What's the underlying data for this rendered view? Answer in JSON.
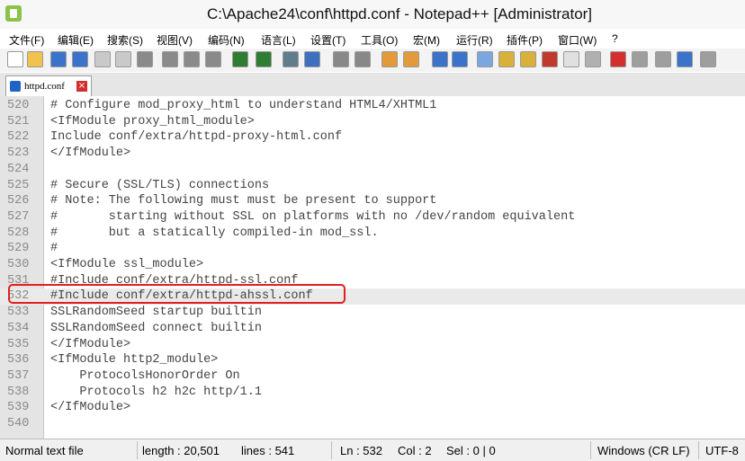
{
  "window": {
    "title": "C:\\Apache24\\conf\\httpd.conf - Notepad++ [Administrator]"
  },
  "menu": [
    "文件(F)",
    "编辑(E)",
    "搜索(S)",
    "视图(V)",
    "编码(N)",
    "语言(L)",
    "设置(T)",
    "工具(O)",
    "宏(M)",
    "运行(R)",
    "插件(P)",
    "窗口(W)",
    "?"
  ],
  "toolbar_icons": [
    "new-icon",
    "open-icon",
    "save-icon",
    "save-all-icon",
    "close-icon",
    "close-all-icon",
    "print-icon",
    "cut-icon",
    "copy-icon",
    "paste-icon",
    "undo-icon",
    "redo-icon",
    "find-icon",
    "replace-icon",
    "zoom-in-icon",
    "zoom-out-icon",
    "sync-v-icon",
    "sync-h-icon",
    "wrap-icon",
    "all-chars-icon",
    "indent-guide-icon",
    "udl-icon",
    "doc-map-icon",
    "function-list-icon",
    "folder-workspace-icon",
    "monitor-icon",
    "record-icon",
    "stop-icon",
    "play-icon",
    "play-multi-icon",
    "save-macro-icon"
  ],
  "tab": {
    "label": "httpd.conf"
  },
  "lines": [
    {
      "n": "520",
      "text": "# Configure mod_proxy_html to understand HTML4/XHTML1"
    },
    {
      "n": "521",
      "text": "<IfModule proxy_html_module>"
    },
    {
      "n": "522",
      "text": "Include conf/extra/httpd-proxy-html.conf"
    },
    {
      "n": "523",
      "text": "</IfModule>"
    },
    {
      "n": "524",
      "text": ""
    },
    {
      "n": "525",
      "text": "# Secure (SSL/TLS) connections"
    },
    {
      "n": "526",
      "text": "# Note: The following must must be present to support"
    },
    {
      "n": "527",
      "text": "#       starting without SSL on platforms with no /dev/random equivalent"
    },
    {
      "n": "528",
      "text": "#       but a statically compiled-in mod_ssl."
    },
    {
      "n": "529",
      "text": "#"
    },
    {
      "n": "530",
      "text": "<IfModule ssl_module>"
    },
    {
      "n": "531",
      "text": "#Include conf/extra/httpd-ssl.conf"
    },
    {
      "n": "532",
      "text": "#Include conf/extra/httpd-ahssl.conf"
    },
    {
      "n": "533",
      "text": "SSLRandomSeed startup builtin"
    },
    {
      "n": "534",
      "text": "SSLRandomSeed connect builtin"
    },
    {
      "n": "535",
      "text": "</IfModule>"
    },
    {
      "n": "536",
      "text": "<IfModule http2_module>"
    },
    {
      "n": "537",
      "text": "    ProtocolsHonorOrder On"
    },
    {
      "n": "538",
      "text": "    Protocols h2 h2c http/1.1"
    },
    {
      "n": "539",
      "text": "</IfModule>"
    },
    {
      "n": "540",
      "text": ""
    }
  ],
  "status": {
    "file_type": "Normal text file",
    "length": "length : 20,501",
    "lines": "lines : 541",
    "ln": "Ln : 532",
    "col": "Col : 2",
    "sel": "Sel : 0 | 0",
    "eol": "Windows (CR LF)",
    "encoding": "UTF-8"
  }
}
